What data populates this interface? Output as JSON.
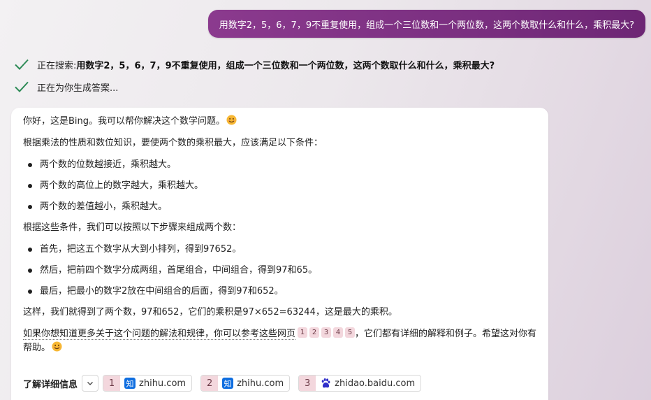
{
  "user_message": "用数字2，5，6，7，9不重复使用，组成一个三位数和一个两位数，这两个数取什么和什么，乘积最大?",
  "status": {
    "searching_prefix": "正在搜索: ",
    "searching_query": "用数字2，5，6，7，9不重复使用，组成一个三位数和一个两位数，这两个数取什么和什么，乘积最大?",
    "generating": "正在为你生成答案..."
  },
  "answer": {
    "greeting": "你好，这是Bing。我可以帮你解决这个数学问题。",
    "intro": "根据乘法的性质和数位知识，要使两个数的乘积最大，应该满足以下条件：",
    "conditions": [
      "两个数的位数越接近，乘积越大。",
      "两个数的高位上的数字越大，乘积越大。",
      "两个数的差值越小，乘积越大。"
    ],
    "steps_intro": "根据这些条件，我们可以按照以下步骤来组成两个数：",
    "steps": [
      "首先，把这五个数字从大到小排列，得到97652。",
      "然后，把前四个数字分成两组，首尾组合，中间组合，得到97和65。",
      "最后，把最小的数字2放在中间组合的后面，得到97和652。"
    ],
    "conclusion": "这样，我们就得到了两个数，97和652，它们的乘积是97×652=63244，这是最大的乘积。",
    "refer_text": "如果你想知道更多关于这个问题的解法和规律，你可以参考这些网页",
    "citations": [
      "1",
      "2",
      "3",
      "4",
      "5"
    ],
    "closing": "，它们都有详细的解释和例子。希望这对你有帮助。"
  },
  "learn_more": {
    "label": "了解详细信息",
    "sources": [
      {
        "num": "1",
        "domain": "zhihu.com",
        "icon": "zhihu-icon"
      },
      {
        "num": "2",
        "domain": "zhihu.com",
        "icon": "zhihu-icon"
      },
      {
        "num": "3",
        "domain": "zhidao.baidu.com",
        "icon": "baidu-paw-icon"
      }
    ]
  },
  "colors": {
    "user_bubble": "#7a2f80",
    "check_green": "#2e8b57",
    "citation_bg": "#f3d7dd",
    "zhihu_blue": "#0f6ee0",
    "baidu_blue": "#2f2ec9"
  }
}
